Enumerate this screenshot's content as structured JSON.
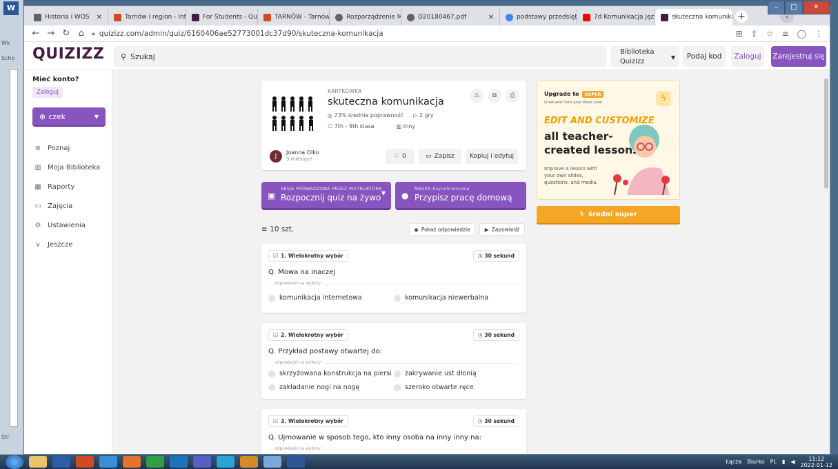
{
  "desktop": {
    "word_icon": "W",
    "side_labels": [
      "Wk",
      "Scho",
      "Str"
    ]
  },
  "browser": {
    "tabs": [
      {
        "title": "Historia i WOS",
        "color": "#5f6368"
      },
      {
        "title": "Tarnów i region - Info",
        "color": "#d14b1f"
      },
      {
        "title": "For Students - Quizizz",
        "color": "#461a42"
      },
      {
        "title": "TARNÓW - Tarnów",
        "color": "#d14b1f"
      },
      {
        "title": "Rozporządzenie Minis",
        "color": "#5f6368"
      },
      {
        "title": "D20180467.pdf",
        "color": "#5f6368"
      },
      {
        "title": "podstawy przedsiębio",
        "color": "#4285f4"
      },
      {
        "title": "7d Komunikacja język",
        "color": "#ff0000"
      },
      {
        "title": "skuteczna komunikac",
        "color": "#461a42"
      }
    ],
    "url": "quizizz.com/admin/quiz/6160406ae52773001dc37d90/skuteczna-komunikacja"
  },
  "header": {
    "logo": "QUIZIZZ",
    "search_placeholder": "Szukaj",
    "library_line1": "Biblioteka",
    "library_line2": "Quizizz",
    "code_label": "Podaj kod",
    "login_label": "Zaloguj",
    "register_label": "Zarejestruj się"
  },
  "sidebar": {
    "account_q": "Mieć konto?",
    "login": "Zaloguj",
    "create": "czek",
    "items": [
      {
        "icon": "explore-icon",
        "glyph": "⊕",
        "label": "Poznaj"
      },
      {
        "icon": "library-icon",
        "glyph": "▥",
        "label": "Moja Biblioteka"
      },
      {
        "icon": "reports-icon",
        "glyph": "▦",
        "label": "Raporty"
      },
      {
        "icon": "classes-icon",
        "glyph": "▭",
        "label": "Zajęcia"
      },
      {
        "icon": "settings-icon",
        "glyph": "⚙",
        "label": "Ustawienia"
      },
      {
        "icon": "chevron-down-icon",
        "glyph": "∨",
        "label": "Jeszcze"
      }
    ]
  },
  "quiz": {
    "type": "KARTKÓWKA",
    "title": "skuteczna komunikacja",
    "accuracy": "73% średnia poprawność",
    "plays": "2 gry",
    "grade": "7th - 9th klasa",
    "subject": "Inny",
    "author": "Joanna Olko",
    "author_initial": "J",
    "time_ago": "3 miesiące",
    "likes": "0",
    "save": "Zapisz",
    "copy_edit": "Kopiuj i edytuj"
  },
  "actions": {
    "live_small": "SESJA PROWADZONA PRZEZ INSTRUKTORA",
    "live_main": "Rozpocznij quiz na żywo",
    "hw_small": "NAUKA Asynchroniczna",
    "hw_main": "Przypisz pracę domową"
  },
  "list": {
    "count": "10 szt.",
    "show_answers": "Pokaż odpowiedzie",
    "preview": "Zapowiedź",
    "answers_label": "odpowiedzi na wybory",
    "questions": [
      {
        "type": "1. Wielokrotny wybór",
        "time": "30 sekund",
        "text": "Q. Mowa na inaczej",
        "options": [
          "komunikacja internetowa",
          "komunikacja niewerbalna"
        ]
      },
      {
        "type": "2. Wielokrotny wybór",
        "time": "30 sekund",
        "text": "Q. Przykład postawy otwartej do:",
        "options": [
          "skrzyżowana konstrukcja na piersi",
          "zakrywanie ust dłonią",
          "zakładanie nogi na nogę",
          "szeroko otwarte ręce"
        ]
      },
      {
        "type": "3. Wielokrotny wybór",
        "time": "30 sekund",
        "text": "Q. Ujmowanie w sposob tego, kto inny osoba na inny inny na:",
        "options": []
      }
    ]
  },
  "promo": {
    "upgrade": "Upgrade to",
    "badge": "SUPER",
    "sub": "Graduate from your Basic plan",
    "head1": "EDIT AND CUSTOMIZE",
    "head2": "all teacher-created lessons",
    "desc": "Improve a lesson with your own slides, questions, and media.",
    "button": "średni super"
  },
  "taskbar": {
    "links": "Łącza",
    "desk": "Biurko",
    "lang": "PL",
    "time": "11:12",
    "date": "2022-01-12"
  },
  "colors": {
    "brand": "#8854c0",
    "logo": "#461a42",
    "super": "#f5a623"
  }
}
